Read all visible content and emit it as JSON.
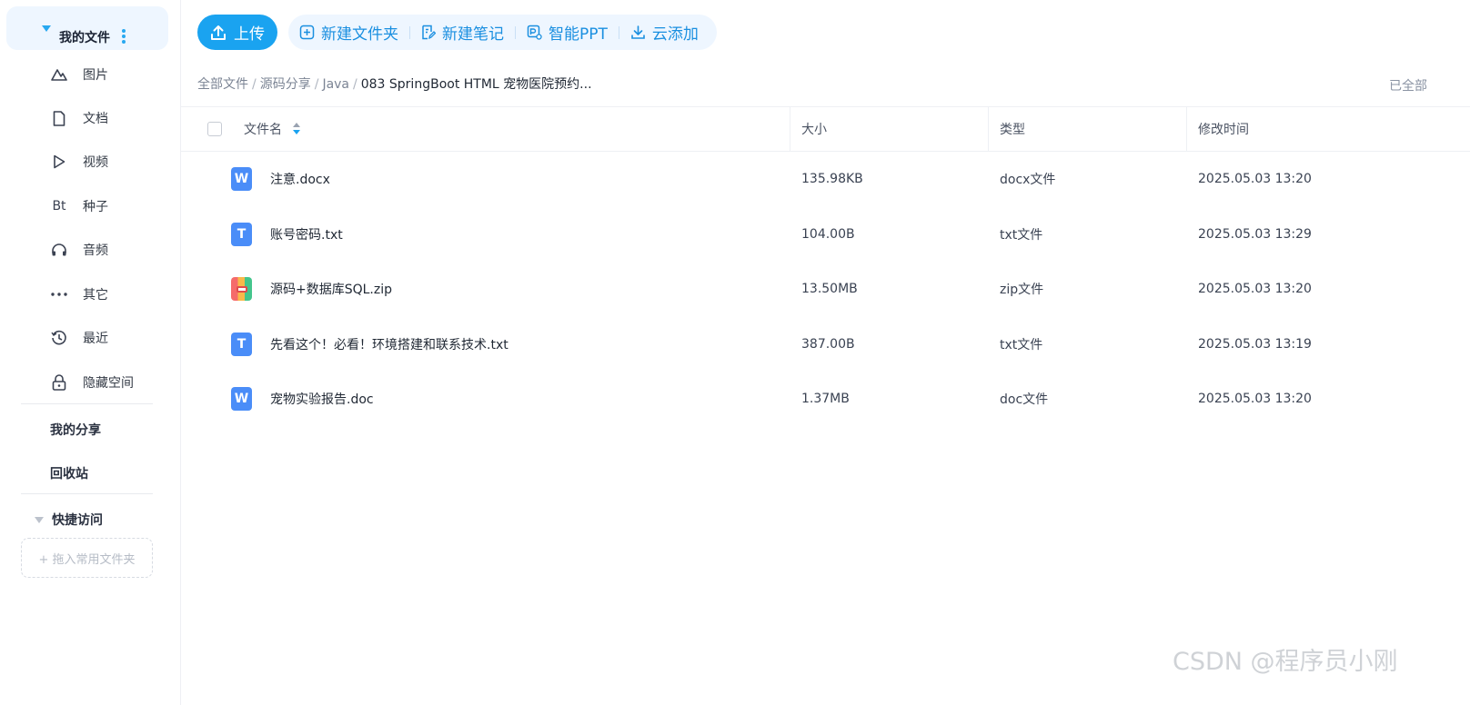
{
  "sidebar": {
    "my_files": "我的文件",
    "items": [
      {
        "label": "图片",
        "icon": "image-icon"
      },
      {
        "label": "文档",
        "icon": "document-icon"
      },
      {
        "label": "视频",
        "icon": "video-icon"
      },
      {
        "label": "种子",
        "icon": "torrent-icon",
        "glyph": "Bt"
      },
      {
        "label": "音频",
        "icon": "headphones-icon"
      },
      {
        "label": "其它",
        "icon": "more-icon"
      },
      {
        "label": "最近",
        "icon": "history-icon"
      },
      {
        "label": "隐藏空间",
        "icon": "lock-icon"
      }
    ],
    "my_share": "我的分享",
    "recycle_bin": "回收站",
    "quick_access": "快捷访问",
    "drop_hint": "+ 拖入常用文件夹"
  },
  "toolbar": {
    "upload": "上传",
    "actions": [
      {
        "label": "新建文件夹",
        "icon": "new-folder-icon"
      },
      {
        "label": "新建笔记",
        "icon": "note-icon"
      },
      {
        "label": "智能PPT",
        "icon": "ppt-icon"
      },
      {
        "label": "云添加",
        "icon": "cloud-download-icon"
      }
    ]
  },
  "breadcrumb": {
    "items": [
      "全部文件",
      "源码分享",
      "Java"
    ],
    "current": "083 SpringBoot HTML 宠物医院预约..."
  },
  "loaded_note": "已全部",
  "table": {
    "columns": {
      "name": "文件名",
      "size": "大小",
      "type": "类型",
      "modified": "修改时间"
    },
    "rows": [
      {
        "name": "注意.docx",
        "size": "135.98KB",
        "type": "docx文件",
        "modified": "2025.05.03 13:20",
        "icon": "word-file-icon",
        "kind": "word",
        "glyph": "W"
      },
      {
        "name": "账号密码.txt",
        "size": "104.00B",
        "type": "txt文件",
        "modified": "2025.05.03 13:29",
        "icon": "text-file-icon",
        "kind": "text",
        "glyph": "T"
      },
      {
        "name": "源码+数据库SQL.zip",
        "size": "13.50MB",
        "type": "zip文件",
        "modified": "2025.05.03 13:20",
        "icon": "zip-file-icon",
        "kind": "zip",
        "glyph": ""
      },
      {
        "name": "先看这个！必看！环境搭建和联系技术.txt",
        "size": "387.00B",
        "type": "txt文件",
        "modified": "2025.05.03 13:19",
        "icon": "text-file-icon",
        "kind": "text",
        "glyph": "T"
      },
      {
        "name": "宠物实验报告.doc",
        "size": "1.37MB",
        "type": "doc文件",
        "modified": "2025.05.03 13:20",
        "icon": "word-file-icon",
        "kind": "word",
        "glyph": "W"
      }
    ]
  },
  "watermark": "CSDN @程序员小刚",
  "colors": {
    "accent": "#1aa3f0",
    "accent_light_bg": "#eef6ff",
    "word_icon": "#4a8df8"
  }
}
